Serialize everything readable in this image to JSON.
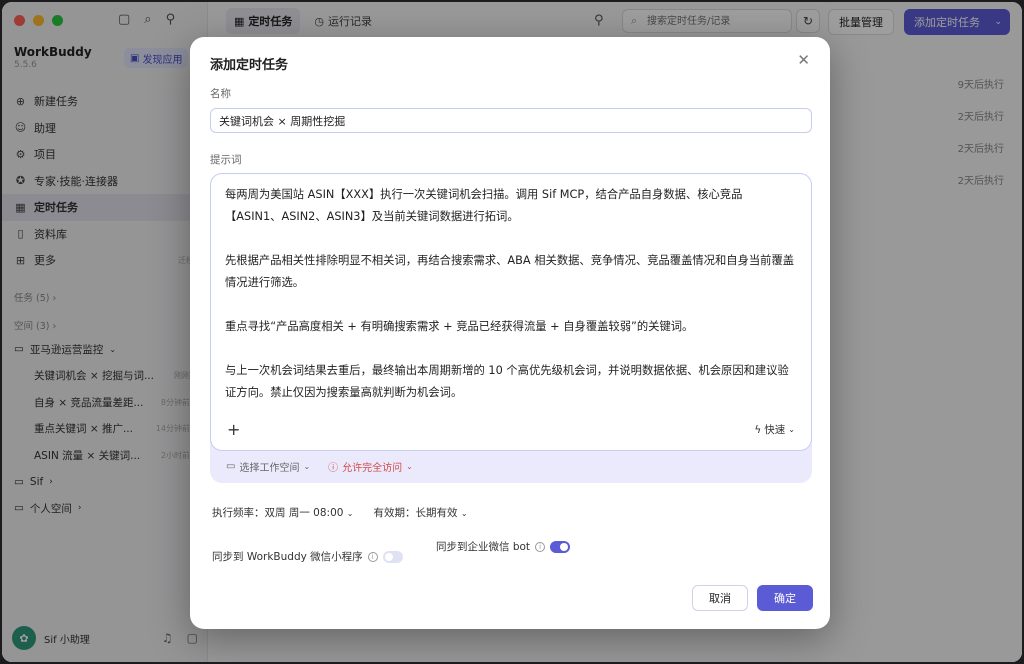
{
  "app": {
    "name": "WorkBuddy",
    "version": "5.5.6",
    "discover_label": "发现应用"
  },
  "sidebar": {
    "nav": [
      {
        "icon": "plus-circle-icon",
        "label": "新建任务"
      },
      {
        "icon": "robot-icon",
        "label": "助理"
      },
      {
        "icon": "project-icon",
        "label": "项目"
      },
      {
        "icon": "expert-icon",
        "label": "专家·技能·连接器"
      },
      {
        "icon": "calendar-icon",
        "label": "定时任务"
      },
      {
        "icon": "book-icon",
        "label": "资料库"
      },
      {
        "icon": "grid-icon",
        "label": "更多",
        "tail": "迁移"
      }
    ],
    "tasks_section": "任务 (5)",
    "spaces_section": "空间 (3)",
    "tree": [
      {
        "label": "亚马逊运营监控",
        "level": 0,
        "expanded": true
      },
      {
        "label": "关键词机会 × 挖掘与词...",
        "level": 1,
        "tail": "刚刚"
      },
      {
        "label": "自身 × 竞品流量差距...",
        "level": 1,
        "tail": "8分钟前"
      },
      {
        "label": "重点关键词 × 推广...",
        "level": 1,
        "tail": "14分钟前"
      },
      {
        "label": "ASIN 流量 × 关键词...",
        "level": 1,
        "tail": "2小时前"
      },
      {
        "label": "Sif",
        "level": 0
      },
      {
        "label": "个人空间",
        "level": 0
      }
    ],
    "user_name": "Sif 小助理"
  },
  "main": {
    "tabs": [
      {
        "label": "定时任务",
        "active": true
      },
      {
        "label": "运行记录",
        "active": false
      }
    ],
    "search_placeholder": "搜索定时任务/记录",
    "batch_label": "批量管理",
    "add_label": "添加定时任务",
    "row_next_runs": [
      "9天后执行",
      "2天后执行",
      "2天后执行",
      "2天后执行"
    ]
  },
  "modal": {
    "title": "添加定时任务",
    "name_label": "名称",
    "name_value": "关键词机会 × 周期性挖掘",
    "prompt_label": "提示词",
    "prompt_paragraphs": [
      "每两周为美国站 ASIN【XXX】执行一次关键词机会扫描。调用 Sif MCP，结合产品自身数据、核心竞品【ASIN1、ASIN2、ASIN3】及当前关键词数据进行拓词。",
      "先根据产品相关性排除明显不相关词，再结合搜索需求、ABA 相关数据、竞争情况、竞品覆盖情况和自身当前覆盖情况进行筛选。",
      "重点寻找“产品高度相关 + 有明确搜索需求 + 竞品已经获得流量 + 自身覆盖较弱”的关键词。",
      "与上一次机会词结果去重后，最终输出本周期新增的 10 个高优先级机会词，并说明数据依据、机会原因和建议验证方向。禁止仅因为搜索量高就判断为机会词。"
    ],
    "quick_label": "快速",
    "workspace_label": "选择工作空间",
    "full_access_label": "允许完全访问",
    "frequency": "执行频率：双周 周一 08:00",
    "validity": "有效期：长期有效",
    "sync_mini": "同步到 WorkBuddy 微信小程序",
    "sync_mini_on": false,
    "sync_wecom": "同步到企业微信 bot",
    "sync_wecom_on": true,
    "cancel_label": "取消",
    "confirm_label": "确定",
    "accent": "#5b5bd6"
  }
}
